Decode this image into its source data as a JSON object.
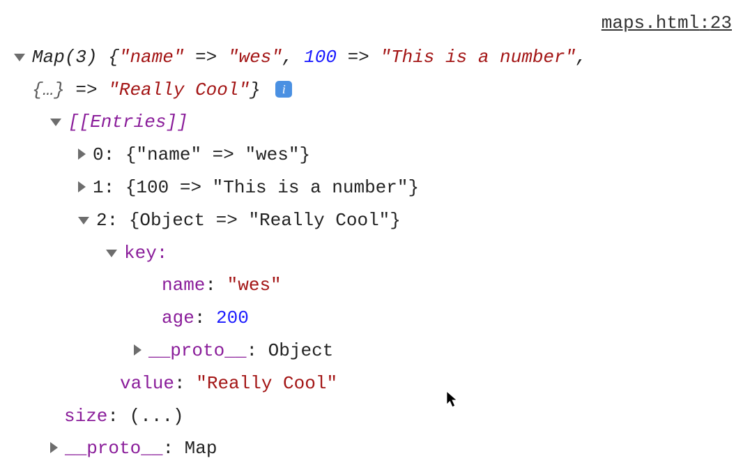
{
  "source": {
    "file": "maps.html",
    "line": "23"
  },
  "summary": {
    "type": "Map",
    "size": "(3)",
    "entry1_key": "\"name\"",
    "entry1_val": "\"wes\"",
    "entry2_key": "100",
    "entry2_val": "\"This is a number\"",
    "entry3_key": "{…}",
    "entry3_val": "\"Really Cool\""
  },
  "entries_label": "[[Entries]]",
  "entries": {
    "e0": {
      "idx": "0",
      "body": "{\"name\" => \"wes\"}"
    },
    "e1": {
      "idx": "1",
      "body": "{100 => \"This is a number\"}"
    },
    "e2": {
      "idx": "2",
      "body": "{Object => \"Really Cool\"}"
    }
  },
  "key_section": {
    "label": "key:",
    "name_prop": "name",
    "name_val": "\"wes\"",
    "age_prop": "age",
    "age_val": "200",
    "proto_prop": "__proto__",
    "proto_val": "Object"
  },
  "value_section": {
    "label": "value",
    "val": "\"Really Cool\""
  },
  "size_line": {
    "label": "size",
    "val": "(...)"
  },
  "proto_line": {
    "label": "__proto__",
    "val": "Map"
  },
  "arrow": "=>",
  "comma": ",",
  "colon": ":",
  "open_brace": "{",
  "close_brace": "}"
}
